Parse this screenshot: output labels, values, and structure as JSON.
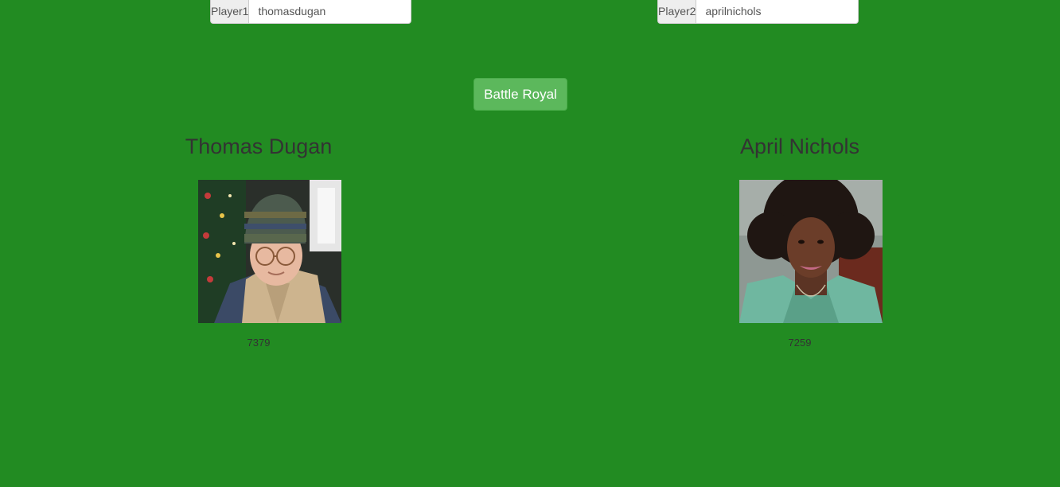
{
  "player1": {
    "label": "Player1",
    "username": "thomasdugan",
    "name": "Thomas Dugan",
    "score": "7379"
  },
  "player2": {
    "label": "Player2",
    "username": "aprilnichols",
    "name": "April Nichols",
    "score": "7259"
  },
  "battle_button": "Battle Royal",
  "colors": {
    "background": "#228b22",
    "button": "#5cb85c"
  }
}
